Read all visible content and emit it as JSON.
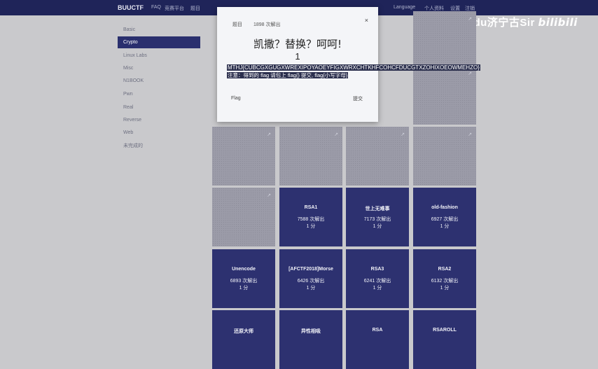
{
  "navbar": {
    "brand": "BUUCTF",
    "links": [
      "FAQ",
      "竞赛平台",
      "题目",
      "Language",
      "个人资料",
      "设置",
      "注销"
    ]
  },
  "watermark": {
    "text": "Edu济宁古Sir",
    "logo": "bilibili"
  },
  "sidebar": {
    "items": [
      {
        "label": "Basic"
      },
      {
        "label": "Crypto",
        "active": true
      },
      {
        "label": "Linux Labs"
      },
      {
        "label": "Misc"
      },
      {
        "label": "N1BOOK"
      },
      {
        "label": "Pwn"
      },
      {
        "label": "Real"
      },
      {
        "label": "Reverse"
      },
      {
        "label": "Web"
      },
      {
        "label": "未完成的"
      }
    ]
  },
  "cards": [
    {
      "row": 0,
      "col": 3,
      "title": "",
      "solves": "",
      "points": "",
      "solved": false
    },
    {
      "row": 1,
      "col": 3,
      "title": "",
      "solves": "",
      "points": "",
      "solved": false
    },
    {
      "row": 2,
      "col": 0,
      "title": "",
      "solves": "",
      "points": "",
      "solved": false
    },
    {
      "row": 2,
      "col": 1,
      "title": "",
      "solves": "",
      "points": "",
      "solved": false
    },
    {
      "row": 2,
      "col": 2,
      "title": "",
      "solves": "",
      "points": "",
      "solved": false
    },
    {
      "row": 2,
      "col": 3,
      "title": "",
      "solves": "",
      "points": "",
      "solved": false
    },
    {
      "row": 3,
      "col": 0,
      "title": "",
      "solves": "",
      "points": "",
      "solved": false
    },
    {
      "row": 3,
      "col": 1,
      "title": "RSA1",
      "solves": "7588 次解出",
      "points": "1 分",
      "solved": true
    },
    {
      "row": 3,
      "col": 2,
      "title": "世上无难事",
      "solves": "7173 次解出",
      "points": "1 分",
      "solved": true
    },
    {
      "row": 3,
      "col": 3,
      "title": "old-fashion",
      "solves": "6927 次解出",
      "points": "1 分",
      "solved": true
    },
    {
      "row": 4,
      "col": 0,
      "title": "Unencode",
      "solves": "6893 次解出",
      "points": "1 分",
      "solved": true
    },
    {
      "row": 4,
      "col": 1,
      "title": "[AFCTF2018]Morse",
      "solves": "6426 次解出",
      "points": "1 分",
      "solved": true
    },
    {
      "row": 4,
      "col": 2,
      "title": "RSA3",
      "solves": "6241 次解出",
      "points": "1 分",
      "solved": true
    },
    {
      "row": 4,
      "col": 3,
      "title": "RSA2",
      "solves": "6132 次解出",
      "points": "1 分",
      "solved": true
    },
    {
      "row": 5,
      "col": 0,
      "title": "还原大师",
      "solves": "",
      "points": "",
      "solved": true
    },
    {
      "row": 5,
      "col": 1,
      "title": "异性相吸",
      "solves": "",
      "points": "",
      "solved": true
    },
    {
      "row": 5,
      "col": 2,
      "title": "RSA",
      "solves": "",
      "points": "",
      "solved": true
    },
    {
      "row": 5,
      "col": 3,
      "title": "RSAROLL",
      "solves": "",
      "points": "",
      "solved": true
    }
  ],
  "modal": {
    "tab1": "题目",
    "tab2": "1898 次解出",
    "close": "×",
    "title": "凯撒？替换？呵呵!",
    "points": "1",
    "cipher": "MTHJ{CUBCGXGUGXWREXIPOYAOEYFIGXWRXCHTKHFCOHCFDUCGTXZOHIXOEOWMEHZO}",
    "hint": "注意：得到的 flag 请包上 flag{} 提交, flag{小写字母}",
    "flag_label": "Flag",
    "flag_value": "",
    "submit": "提交"
  }
}
